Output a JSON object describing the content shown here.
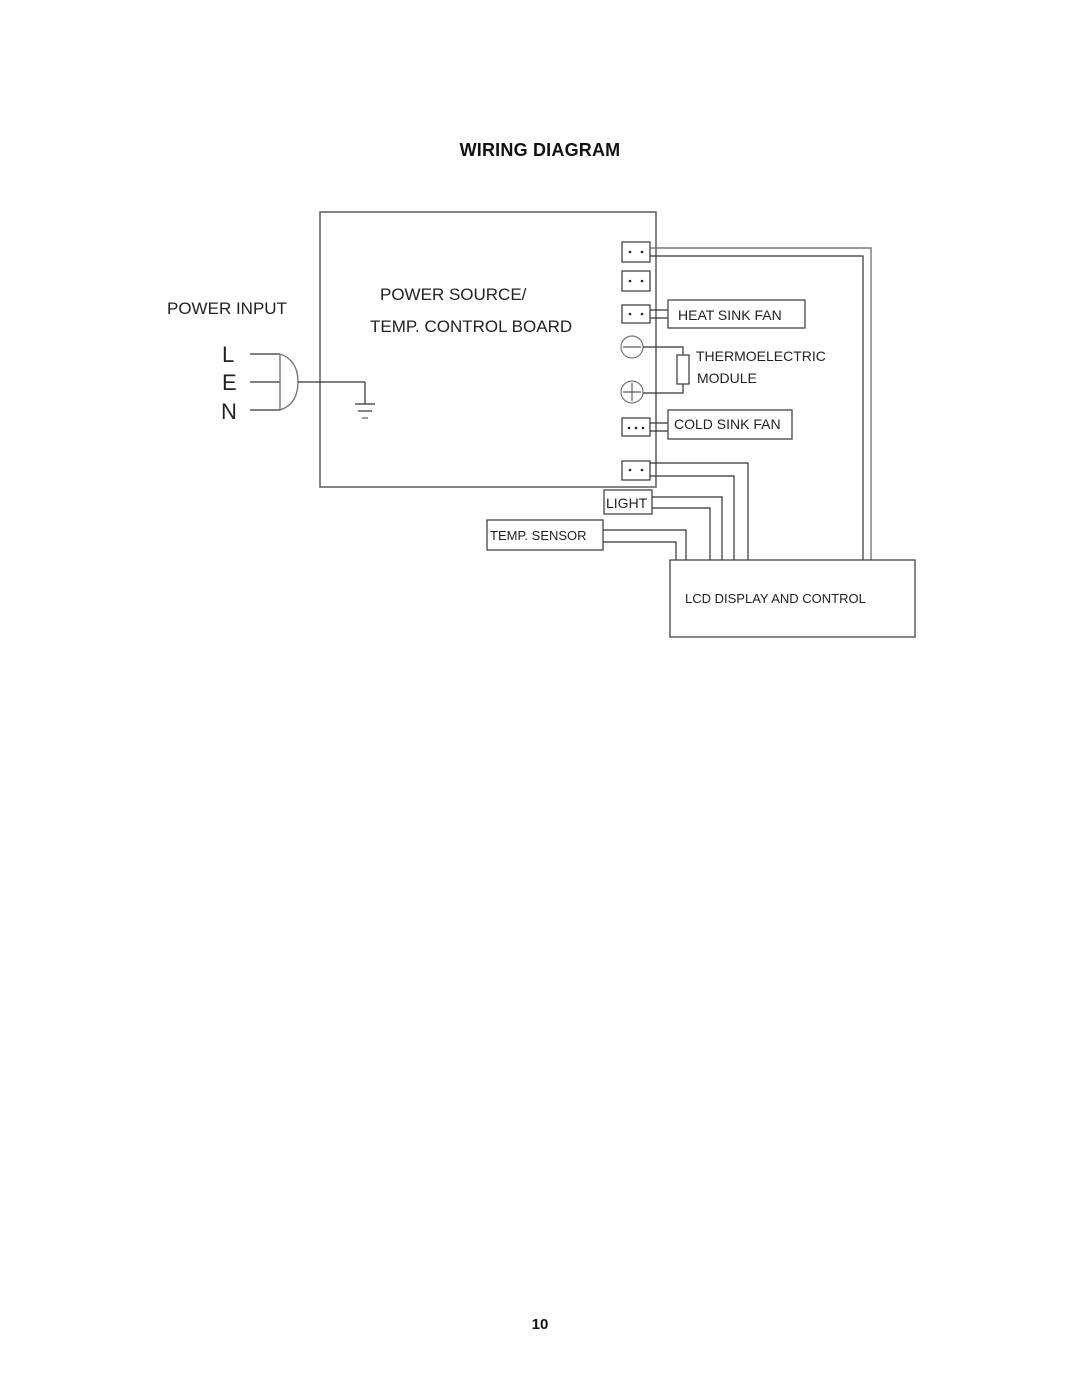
{
  "page": {
    "title": "WIRING DIAGRAM",
    "page_number": "10"
  },
  "diagram": {
    "power_input": {
      "label": "POWER INPUT",
      "terminals": [
        "L",
        "E",
        "N"
      ]
    },
    "board": {
      "label_line1": "POWER SOURCE/",
      "label_line2": "TEMP. CONTROL BOARD"
    },
    "components": {
      "heat_sink_fan": "HEAT SINK FAN",
      "thermoelectric_line1": "THERMOELECTRIC",
      "thermoelectric_line2": "MODULE",
      "cold_sink_fan": "COLD SINK FAN",
      "light": "LIGHT",
      "temp_sensor": "TEMP. SENSOR",
      "lcd": "LCD DISPLAY AND CONTROL"
    },
    "connectors": [
      {
        "id": "c1",
        "pins": 2
      },
      {
        "id": "c2",
        "pins": 2
      },
      {
        "id": "c3",
        "pins": 2
      },
      {
        "id": "c4",
        "pins": 3
      },
      {
        "id": "c5",
        "pins": 2
      }
    ],
    "terminal_symbols": [
      "minus",
      "plus"
    ]
  }
}
